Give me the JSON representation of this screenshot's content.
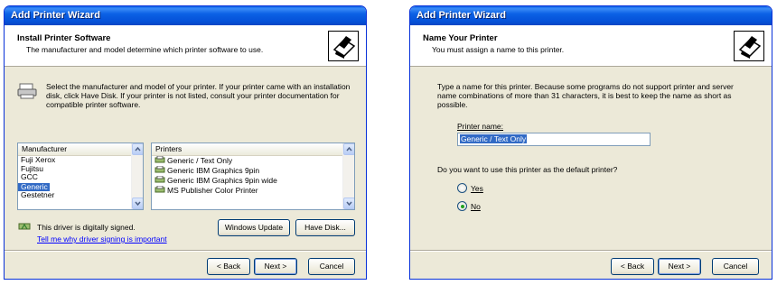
{
  "wizard1": {
    "title": "Add Printer Wizard",
    "header_title": "Install Printer Software",
    "header_subtitle": "The manufacturer and model determine which printer software to use.",
    "instructions_line1": "Select the manufacturer and model of your printer. If your printer came with an installation",
    "instructions_line2": "disk, click Have Disk. If your printer is not listed, consult your printer documentation for",
    "instructions_line3": "compatible printer software.",
    "manufacturer_header": "Manufacturer",
    "manufacturers": [
      "Fuji Xerox",
      "Fujitsu",
      "GCC",
      "Generic",
      "Gestetner"
    ],
    "selected_manufacturer": "Generic",
    "printers_header": "Printers",
    "printers": [
      "Generic / Text Only",
      "Generic IBM Graphics 9pin",
      "Generic IBM Graphics 9pin wide",
      "MS Publisher Color Printer"
    ],
    "selected_printer": "Generic / Text Only",
    "signed_text": "This driver is digitally signed.",
    "signing_link": "Tell me why driver signing is important",
    "windows_update_button": "Windows Update",
    "have_disk_button": "Have Disk...",
    "back_button": "< Back",
    "next_button": "Next >",
    "cancel_button": "Cancel"
  },
  "wizard2": {
    "title": "Add Printer Wizard",
    "header_title": "Name Your Printer",
    "header_subtitle": "You must assign a name to this printer.",
    "instructions_line1": "Type a name for this printer. Because some programs do not support printer and server",
    "instructions_line2": "name combinations of more than 31 characters, it is best to keep the name as short as",
    "instructions_line3": "possible.",
    "printer_name_label": "Printer name:",
    "printer_name_value": "Generic / Text Only",
    "default_question": "Do you want to use this printer as the default printer?",
    "yes_label": "Yes",
    "no_label": "No",
    "default_selection": "No",
    "back_button": "< Back",
    "next_button": "Next >",
    "cancel_button": "Cancel"
  },
  "colors": {
    "titlebar": "#0b61e5",
    "dialog_face": "#ece9d8",
    "selection": "#316ac5",
    "link": "#0000ff"
  }
}
